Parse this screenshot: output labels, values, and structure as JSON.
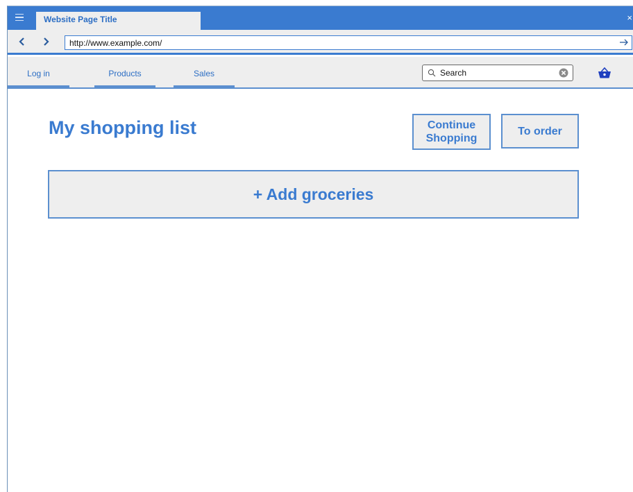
{
  "browser": {
    "tab_title": "Website Page Title",
    "close_symbol": "×",
    "url": "http://www.example.com/",
    "accent_color": "#3a7bd0",
    "icons": [
      "menu-icon",
      "back-icon",
      "forward-icon",
      "go-arrow-icon",
      "close-icon"
    ]
  },
  "site_nav": {
    "items": [
      {
        "label": "Log in"
      },
      {
        "label": "Products"
      },
      {
        "label": "Sales"
      }
    ],
    "search": {
      "value": "Search"
    },
    "icons": [
      "search-icon",
      "clear-icon",
      "cart-icon"
    ]
  },
  "main": {
    "title": "My shopping list",
    "continue_label_line1": "Continue",
    "continue_label_line2": "Shopping",
    "order_label": "To order",
    "add_label": "+ Add groceries"
  }
}
